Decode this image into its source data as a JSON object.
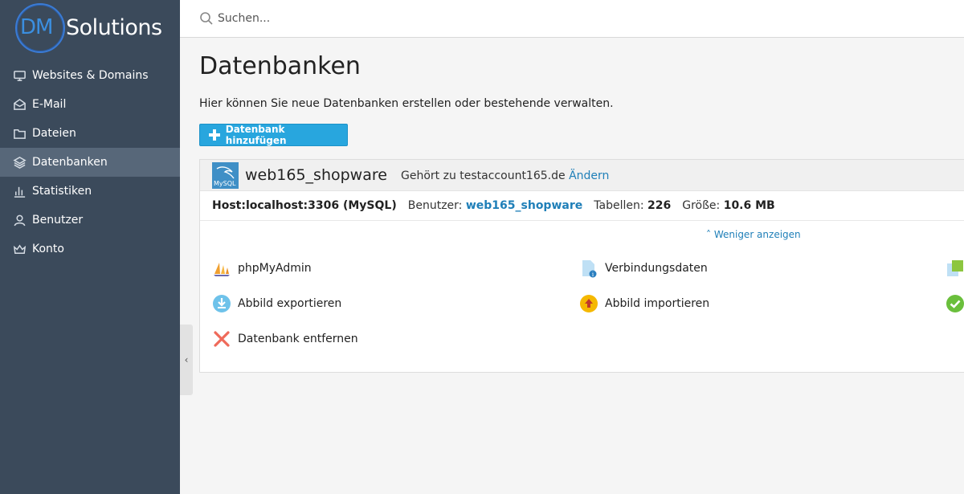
{
  "brand": {
    "logo_dm": "DM",
    "logo_solutions": "Solutions"
  },
  "sidebar": {
    "items": [
      {
        "label": "Websites & Domains",
        "icon": "monitor-icon",
        "active": false
      },
      {
        "label": "E-Mail",
        "icon": "envelope-icon",
        "active": false
      },
      {
        "label": "Dateien",
        "icon": "folder-icon",
        "active": false
      },
      {
        "label": "Datenbanken",
        "icon": "layers-icon",
        "active": true
      },
      {
        "label": "Statistiken",
        "icon": "bar-chart-icon",
        "active": false
      },
      {
        "label": "Benutzer",
        "icon": "user-icon",
        "active": false
      },
      {
        "label": "Konto",
        "icon": "crown-icon",
        "active": false
      }
    ]
  },
  "search": {
    "placeholder": "Suchen..."
  },
  "page": {
    "title": "Datenbanken",
    "description": "Hier können Sie neue Datenbanken erstellen oder bestehende verwalten.",
    "add_button": "Datenbank hinzufügen"
  },
  "database": {
    "name": "web165_shopware",
    "owner_prefix": "Gehört zu testaccount165.de",
    "owner_link": "Ändern",
    "logo_text": "MySQL",
    "host": "Host:localhost:3306 (MySQL)",
    "user_label": "Benutzer:",
    "user_value": "web165_shopware",
    "tables_label": "Tabellen:",
    "tables_value": "226",
    "size_label": "Größe:",
    "size_value": "10.6 MB",
    "toggle_label": "Weniger anzeigen"
  },
  "actions": {
    "phpmyadmin": "phpMyAdmin",
    "connection": "Verbindungsdaten",
    "export": "Abbild exportieren",
    "import": "Abbild importieren",
    "remove": "Datenbank entfernen"
  },
  "colors": {
    "sidebar": "#3b4a5b",
    "active": "#576779",
    "accent": "#28a6de",
    "link": "#1f7fb8"
  }
}
